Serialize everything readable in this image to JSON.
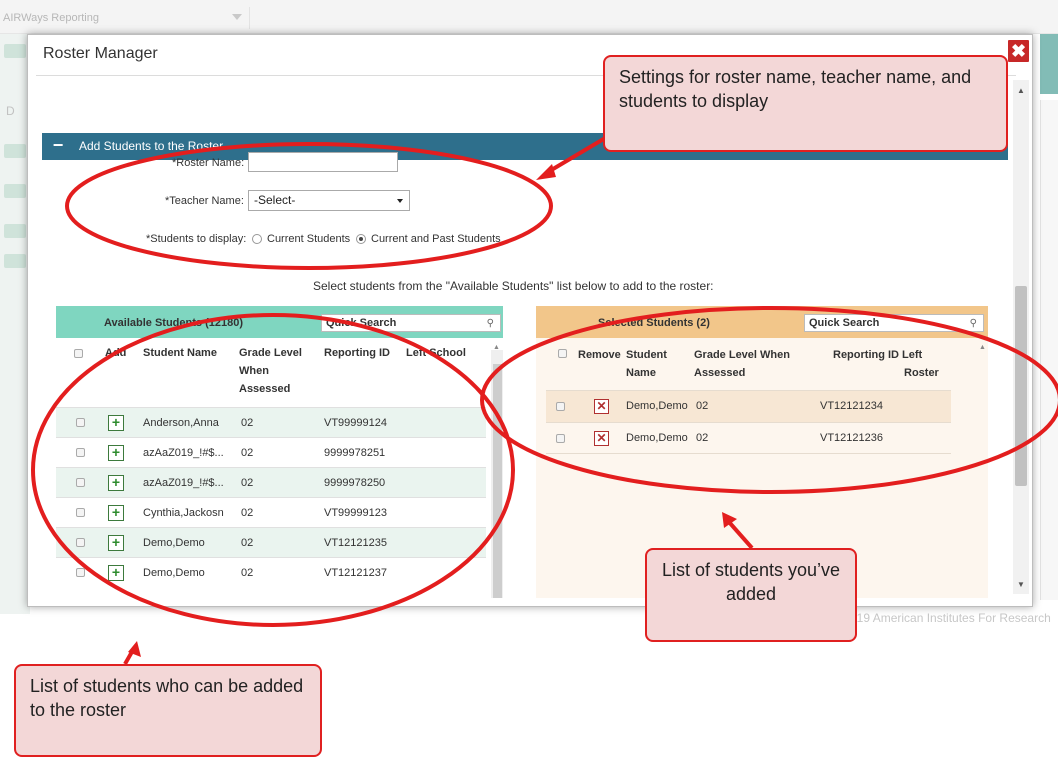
{
  "background": {
    "app_dropdown": "AIRWays Reporting",
    "side_letter": "D",
    "footer": "019 American Institutes For Research"
  },
  "modal": {
    "title": "Roster Manager",
    "close_symbol": "✖",
    "section_title": "Add Students to the Roster",
    "form": {
      "roster_name_label": "*Roster Name:",
      "roster_name_value": "",
      "teacher_name_label": "*Teacher Name:",
      "teacher_name_selected": "-Select-",
      "students_display_label": "*Students to display:",
      "option_current": "Current Students",
      "option_current_past": "Current and Past Students",
      "selected_option": "Current and Past Students"
    },
    "instruction": "Select students from the \"Available Students\" list below to add to the roster:",
    "available": {
      "title": "Available Students (12180)",
      "search_placeholder": "Quick Search",
      "columns": [
        "Add",
        "Student Name",
        "Grade Level When Assessed",
        "Reporting ID",
        "Left School"
      ],
      "col_grade_1": "Grade Level",
      "col_grade_2": "When",
      "col_grade_3": "Assessed",
      "rows": [
        {
          "name": "Anderson,Anna",
          "grade": "02",
          "id": "VT99999124"
        },
        {
          "name": "azAaZ019_!#$...",
          "grade": "02",
          "id": "9999978251"
        },
        {
          "name": "azAaZ019_!#$...",
          "grade": "02",
          "id": "9999978250"
        },
        {
          "name": "Cynthia,Jackosn",
          "grade": "02",
          "id": "VT99999123"
        },
        {
          "name": "Demo,Demo",
          "grade": "02",
          "id": "VT12121235"
        },
        {
          "name": "Demo,Demo",
          "grade": "02",
          "id": "VT12121237"
        }
      ]
    },
    "selected": {
      "title": "Selected Students (2)",
      "search_placeholder": "Quick Search",
      "col_remove": "Remove",
      "col_student_1": "Student",
      "col_student_2": "Name",
      "col_grade_1": "Grade Level When",
      "col_grade_2": "Assessed",
      "col_rid_1": "Reporting ID Left",
      "col_rid_2": "Roster",
      "rows": [
        {
          "name": "Demo,Demo",
          "grade": "02",
          "id": "VT12121234"
        },
        {
          "name": "Demo,Demo",
          "grade": "02",
          "id": "VT12121236"
        }
      ]
    }
  },
  "callouts": {
    "settings": "Settings for roster name, teacher name, and students to display",
    "added": "List of students you’ve added",
    "available": "List of students who can be added to the roster"
  },
  "colors": {
    "section_bar": "#2e6f8c",
    "available_header": "#7fd6c0",
    "selected_header": "#f2c68a",
    "callout_border": "#e02020",
    "callout_fill": "#f3d7d7",
    "close_button": "#c72828"
  }
}
